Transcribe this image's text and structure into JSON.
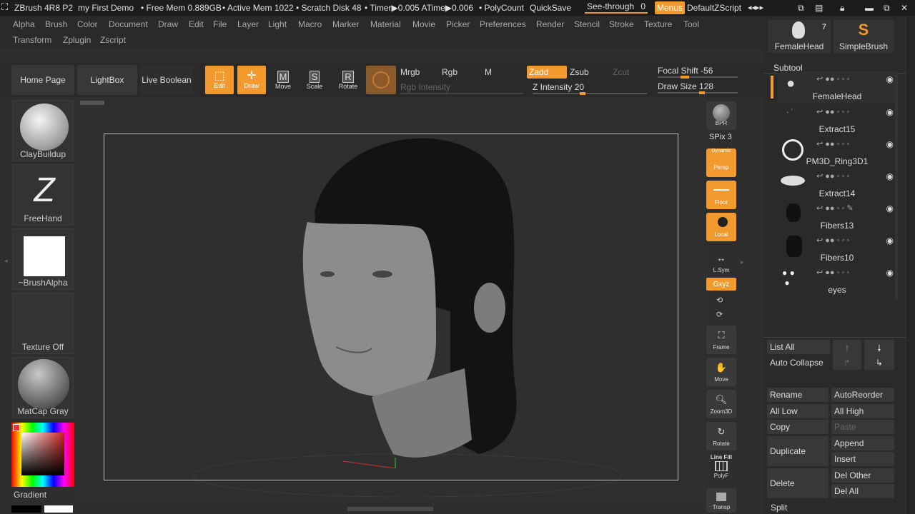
{
  "topbar": {
    "app": "ZBrush 4R8 P2",
    "project": "my First Demo",
    "free_mem": "• Free Mem 0.889GB",
    "active_mem": "• Active Mem 1022",
    "scratch": "• Scratch Disk 48",
    "timer": "• Timer▶0.005 ATime▶0.006",
    "polycount": "• PolyCount",
    "quicksave": "QuickSave",
    "seethrough": "See-through",
    "seethrough_val": "0",
    "menus": "Menus",
    "zscript": "DefaultZScript"
  },
  "menu": [
    "Alpha",
    "Brush",
    "Color",
    "Document",
    "Draw",
    "Edit",
    "File",
    "Layer",
    "Light",
    "Macro",
    "Marker",
    "Material",
    "Movie",
    "Picker",
    "Preferences",
    "Render",
    "Stencil",
    "Stroke",
    "Texture",
    "Tool"
  ],
  "menu2": [
    "Transform",
    "Zplugin",
    "Zscript"
  ],
  "toolbar": {
    "home": "Home Page",
    "lightbox": "LightBox",
    "liveboolean": "Live Boolean",
    "edit": "Edit",
    "draw": "Draw",
    "move": "Move",
    "scale": "Scale",
    "rotate": "Rotate",
    "mrgb": "Mrgb",
    "rgb": "Rgb",
    "m": "M",
    "rgb_intensity": "Rgb Intensity",
    "zadd": "Zadd",
    "zsub": "Zsub",
    "zcut": "Zcut",
    "z_intensity": "Z Intensity 20",
    "focal_shift": "Focal Shift -56",
    "draw_size": "Draw Size 128"
  },
  "leftshelf": {
    "brush1": "ClayBuildup",
    "brush2": "FreeHand",
    "alpha": "~BrushAlpha",
    "texture": "Texture Off",
    "material": "MatCap Gray",
    "gradient": "Gradient"
  },
  "rightshelf": {
    "bpr": "BPR",
    "spix": "SPix 3",
    "persp_top": "Dynamic",
    "persp": "Persp",
    "floor": "Floor",
    "local": "Local",
    "lsym": "L.Sym",
    "xyz": "Gxyz",
    "frame": "Frame",
    "move": "Move",
    "zoom": "Zoom3D",
    "rotate": "Rotate",
    "linefill": "Line Fill",
    "polyf": "PolyF",
    "transp": "Transp"
  },
  "subtool": {
    "fh_count": "7",
    "fh_label": "FemaleHead",
    "sb_label": "SimpleBrush",
    "title": "Subtool",
    "items": [
      "FemaleHead",
      "Extract15",
      "PM3D_Ring3D1",
      "Extract14",
      "Fibers13",
      "Fibers10",
      "eyes"
    ],
    "list_all": "List All",
    "auto_collapse": "Auto Collapse",
    "rename": "Rename",
    "autoreorder": "AutoReorder",
    "all_low": "All Low",
    "all_high": "All High",
    "copy": "Copy",
    "paste": "Paste",
    "append": "Append",
    "duplicate": "Duplicate",
    "insert": "Insert",
    "delete": "Delete",
    "del_other": "Del Other",
    "del_all": "Del All",
    "split": "Split"
  },
  "colors": {
    "accent": "#f29a2e"
  }
}
